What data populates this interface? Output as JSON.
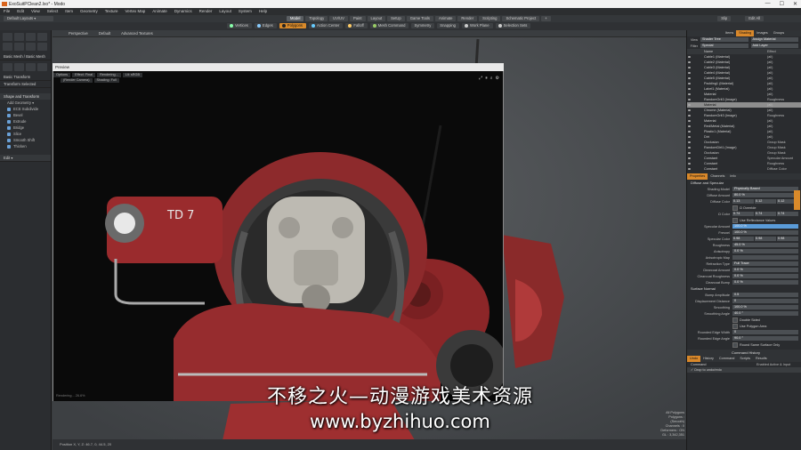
{
  "window": {
    "title": "ExoSuitPClean2.lxo* - Modo",
    "controls": [
      "—",
      "☐",
      "✕"
    ]
  },
  "menu": [
    "File",
    "Edit",
    "View",
    "Select",
    "Item",
    "Geometry",
    "Texture",
    "Vertex Map",
    "Animate",
    "Dynamics",
    "Render",
    "Layout",
    "System",
    "Help"
  ],
  "layout_bar": {
    "layout_name": "Default Layouts ▾",
    "tabs": [
      "Model",
      "Topology",
      "UV/UV",
      "Paint",
      "Layout",
      "SetUp",
      "Game Tools",
      "Animate",
      "Render",
      "Scripting",
      "Schematic Project"
    ],
    "active_tab": "Model",
    "add": "+",
    "right_buttons": [
      "Slip",
      "Edit All"
    ]
  },
  "toolbar": {
    "items": [
      "Vertices",
      "Edges",
      "Polygons",
      "Action Center",
      "Falloff",
      "Mesh Command",
      "Symmetry",
      "Snapping",
      "Work Plane",
      "Selection Sets"
    ],
    "active": "Polygons"
  },
  "left_panel": {
    "section1": "Basic Mesh / Basic Mesh",
    "section2": "Basic Transform",
    "section3": "Transform Selected",
    "group_title": "Shape and Transform",
    "add_geometry": "Add Geometry ▾",
    "sub_items": [
      "ECE Subdivide",
      "Bevel",
      "Extrude",
      "Bridge",
      "Slice",
      "Smooth Shift",
      "Thicken"
    ],
    "dropdown": "Edit ▾"
  },
  "viewport": {
    "labels": [
      "Perspective",
      "Default",
      "Advanced Textures"
    ]
  },
  "preview": {
    "title": "Preview",
    "tabs_row1": [
      "Options",
      "Effect: Final",
      "Rendering...",
      "Lit: sRGB"
    ],
    "tabs_row2": [
      "(Render Camera)",
      "Shading: Full"
    ],
    "bottom_left": "Rendering... 26.6%",
    "decal_text": "TD 7"
  },
  "right_panel": {
    "top_tabs": [
      "Items",
      "Shading",
      "Images",
      "Groups"
    ],
    "active_top_tab": "Shading",
    "view_label": "View",
    "view_value": "Shader Tree",
    "view_btn": "Assign Material",
    "filter_label": "Filter",
    "filter_value": "Special",
    "filter_btn": "Add Layer",
    "columns": [
      "Name",
      "Effect"
    ],
    "rows": [
      {
        "name": "Cable1 (Material)",
        "effect": "(all)"
      },
      {
        "name": "Cable2 (Material)",
        "effect": "(all)"
      },
      {
        "name": "Cable3 (Material)",
        "effect": "(all)"
      },
      {
        "name": "Cable4 (Material)",
        "effect": "(all)"
      },
      {
        "name": "Cable5 (Material)",
        "effect": "(all)"
      },
      {
        "name": "Padding1 (Material)",
        "effect": "(all)"
      },
      {
        "name": "Label1 (Material)",
        "effect": "(all)"
      },
      {
        "name": "Material",
        "effect": "(all)"
      },
      {
        "name": "RandomGrit3 (Image)",
        "effect": "Roughness"
      },
      {
        "name": "Material",
        "effect": "(all)"
      },
      {
        "name": "Chrome (Material)",
        "effect": "(all)"
      },
      {
        "name": "RandomGrit3 (Image)",
        "effect": "Roughness"
      },
      {
        "name": "Material",
        "effect": "(all)"
      },
      {
        "name": "Red/Metal (Material)",
        "effect": "(all)"
      },
      {
        "name": "Plastic1 (Material)",
        "effect": "(all)"
      },
      {
        "name": "Dirt",
        "effect": "(all)"
      },
      {
        "name": "Occlusion",
        "effect": "Group Mask"
      },
      {
        "name": "RandomDirt1 (Image)",
        "effect": "Group Mask"
      },
      {
        "name": "Occlusion",
        "effect": "Group Mask"
      },
      {
        "name": "Constant",
        "effect": "Specular Amount"
      },
      {
        "name": "Constant",
        "effect": "Roughness"
      },
      {
        "name": "Constant",
        "effect": "Diffuse Color"
      }
    ],
    "highlight_row": 9,
    "props_tabs": [
      "Properties",
      "Channels",
      "Info"
    ],
    "active_props_tab": "Properties",
    "props_section": "Diffuse and Specular",
    "side_tab": "Material Ref",
    "props": [
      {
        "label": "Shading Model",
        "value": "Physically Based"
      },
      {
        "label": "Diffuse Amount",
        "value": "80.0 %"
      },
      {
        "label": "Diffuse Color",
        "values": [
          "0.13",
          "0.12",
          "0.12"
        ]
      },
      {
        "label": "",
        "check": "Ω Override"
      },
      {
        "label": "Ω Color",
        "values": [
          "0.74",
          "0.74",
          "0.74"
        ]
      },
      {
        "label": "",
        "check": "Use Reflectance Values"
      },
      {
        "label": "Specular Amount",
        "value": "100.0 %",
        "sel": true
      },
      {
        "label": "Fresnel",
        "value": "100.0 %"
      },
      {
        "label": "Specular Color",
        "values": [
          "0.98",
          "0.98",
          "0.98"
        ]
      },
      {
        "label": "Roughness",
        "value": "45.0 %"
      },
      {
        "label": "Anisotropy",
        "value": "0.0 %"
      },
      {
        "label": "Anisotropic Map",
        "value": ""
      },
      {
        "label": "Refraction Type",
        "value": "Full Trace"
      },
      {
        "label": "Clearcoat Amount",
        "value": "0.0 %"
      },
      {
        "label": "Clearcoat Roughness",
        "value": "0.0 %"
      },
      {
        "label": "Clearcoat Bump",
        "value": "0.0 %"
      }
    ],
    "surface_section": "Surface Normal",
    "surface_props": [
      {
        "label": "Bump Amplitude",
        "value": "0.5"
      },
      {
        "label": "Displacement Distance",
        "value": "0"
      },
      {
        "label": "Smoothing",
        "value": "100.0 %"
      },
      {
        "label": "Smoothing Angle",
        "value": "40.0 °"
      },
      {
        "label": "",
        "check": "Double Sided"
      },
      {
        "label": "",
        "check": "Use Polygon Area"
      },
      {
        "label": "Rounded Edge Width",
        "value": "0"
      },
      {
        "label": "Rounded Edge Angle",
        "value": "90.0 °"
      },
      {
        "label": "",
        "check": "Round Same Surface Only"
      }
    ],
    "command_history": "Command History",
    "cmd_tabs": [
      "Undo",
      "History",
      "Command",
      "Scripts",
      "Results"
    ],
    "cmd_columns": [
      "Command",
      "Enabled Active & Input"
    ],
    "cmd_row": "✓ Drop to undo/redo"
  },
  "info_overlay": [
    "All Polygons",
    "Polygons : (Smooth)",
    "Channels : 0",
    "Deformers : ON",
    "GL : 3,342,351"
  ],
  "statusbar": "Position X, Y, Z: 46.7, 0, 44.5, 20",
  "watermark": {
    "line1": "不移之火—动漫游戏美术资源",
    "line2": "www.byzhihuo.com"
  }
}
